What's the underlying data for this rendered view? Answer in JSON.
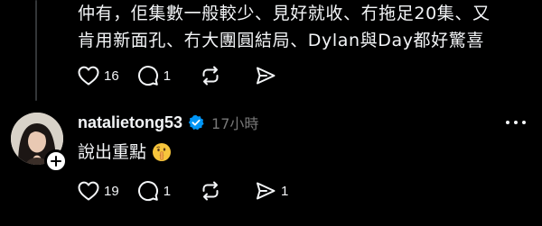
{
  "previous_post": {
    "text_lines": [
      "仲有，佢集數一般較少、見好就收、冇拖足20集、又",
      "肯用新面孔、冇大團圓結局、Dylan與Day都好驚喜"
    ],
    "actions": {
      "like_count": "16",
      "reply_count": "1",
      "repost_count": "",
      "share_count": ""
    }
  },
  "reply": {
    "username": "natalietong53",
    "verified": true,
    "timestamp": "17小時",
    "text": "說出重點",
    "emoji_icon": "shushing-face-emoji",
    "actions": {
      "like_count": "19",
      "reply_count": "1",
      "repost_count": "",
      "share_count": "1"
    }
  },
  "colors": {
    "background": "#000000",
    "text": "#f3f5f7",
    "secondary_text": "#777777",
    "thread_line": "#333638",
    "verified_badge": "#0095f6"
  }
}
